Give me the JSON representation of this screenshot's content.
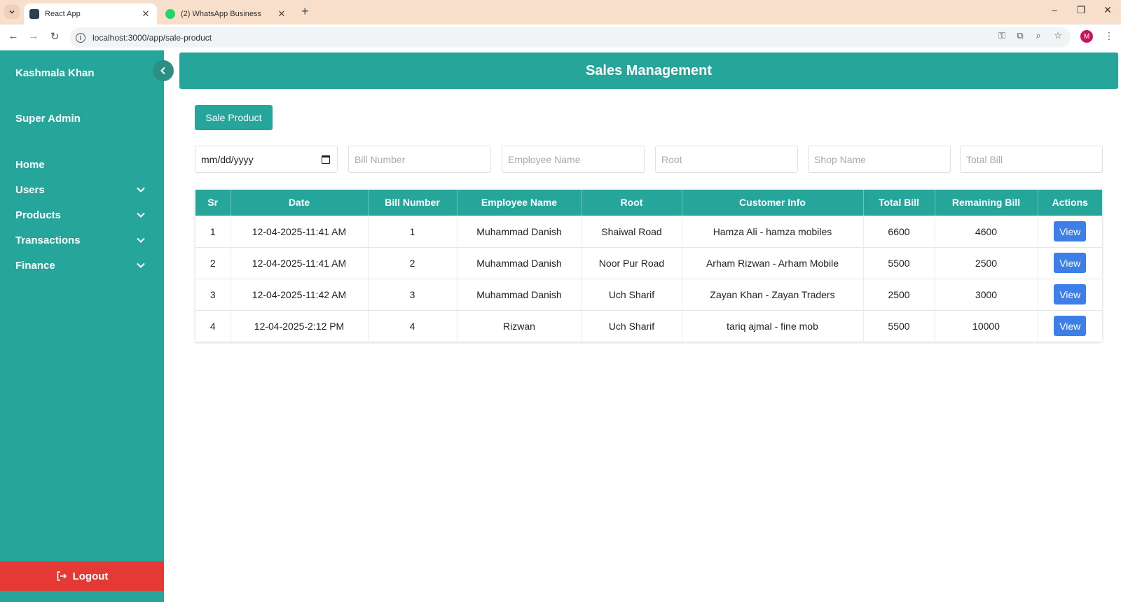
{
  "browser": {
    "tabs": [
      {
        "label": "React App",
        "active": true
      },
      {
        "label": "(2) WhatsApp Business",
        "active": false
      }
    ],
    "url": "localhost:3000/app/sale-product"
  },
  "sidebar": {
    "user_name": "Kashmala Khan",
    "role": "Super Admin",
    "items": [
      {
        "label": "Home",
        "has_children": false
      },
      {
        "label": "Users",
        "has_children": true
      },
      {
        "label": "Products",
        "has_children": true
      },
      {
        "label": "Transactions",
        "has_children": true
      },
      {
        "label": "Finance",
        "has_children": true
      }
    ],
    "logout_label": "Logout"
  },
  "page": {
    "title": "Sales Management",
    "sale_button": "Sale Product"
  },
  "filters": {
    "date_value": "mm/dd/yyyy",
    "bill_number_placeholder": "Bill Number",
    "employee_name_placeholder": "Employee Name",
    "root_placeholder": "Root",
    "shop_name_placeholder": "Shop Name",
    "total_bill_placeholder": "Total Bill"
  },
  "table": {
    "columns": [
      "Sr",
      "Date",
      "Bill Number",
      "Employee Name",
      "Root",
      "Customer Info",
      "Total Bill",
      "Remaining Bill",
      "Actions"
    ],
    "rows": [
      {
        "sr": "1",
        "date": "12-04-2025-11:41 AM",
        "bill": "1",
        "employee": "Muhammad Danish",
        "root": "Shaiwal Road",
        "customer": "Hamza Ali - hamza mobiles",
        "total": "6600",
        "remaining": "4600",
        "action": "View"
      },
      {
        "sr": "2",
        "date": "12-04-2025-11:41 AM",
        "bill": "2",
        "employee": "Muhammad Danish",
        "root": "Noor Pur Road",
        "customer": "Arham Rizwan - Arham Mobile",
        "total": "5500",
        "remaining": "2500",
        "action": "View"
      },
      {
        "sr": "3",
        "date": "12-04-2025-11:42 AM",
        "bill": "3",
        "employee": "Muhammad Danish",
        "root": "Uch Sharif",
        "customer": "Zayan Khan - Zayan Traders",
        "total": "2500",
        "remaining": "3000",
        "action": "View"
      },
      {
        "sr": "4",
        "date": "12-04-2025-2:12 PM",
        "bill": "4",
        "employee": "Rizwan",
        "root": "Uch Sharif",
        "customer": "tariq ajmal - fine mob",
        "total": "5500",
        "remaining": "10000",
        "action": "View"
      }
    ]
  },
  "colors": {
    "primary": "#26a69a",
    "danger": "#e53935",
    "view_button": "#3d7fe6",
    "browser_frame": "#f8dfcc"
  }
}
